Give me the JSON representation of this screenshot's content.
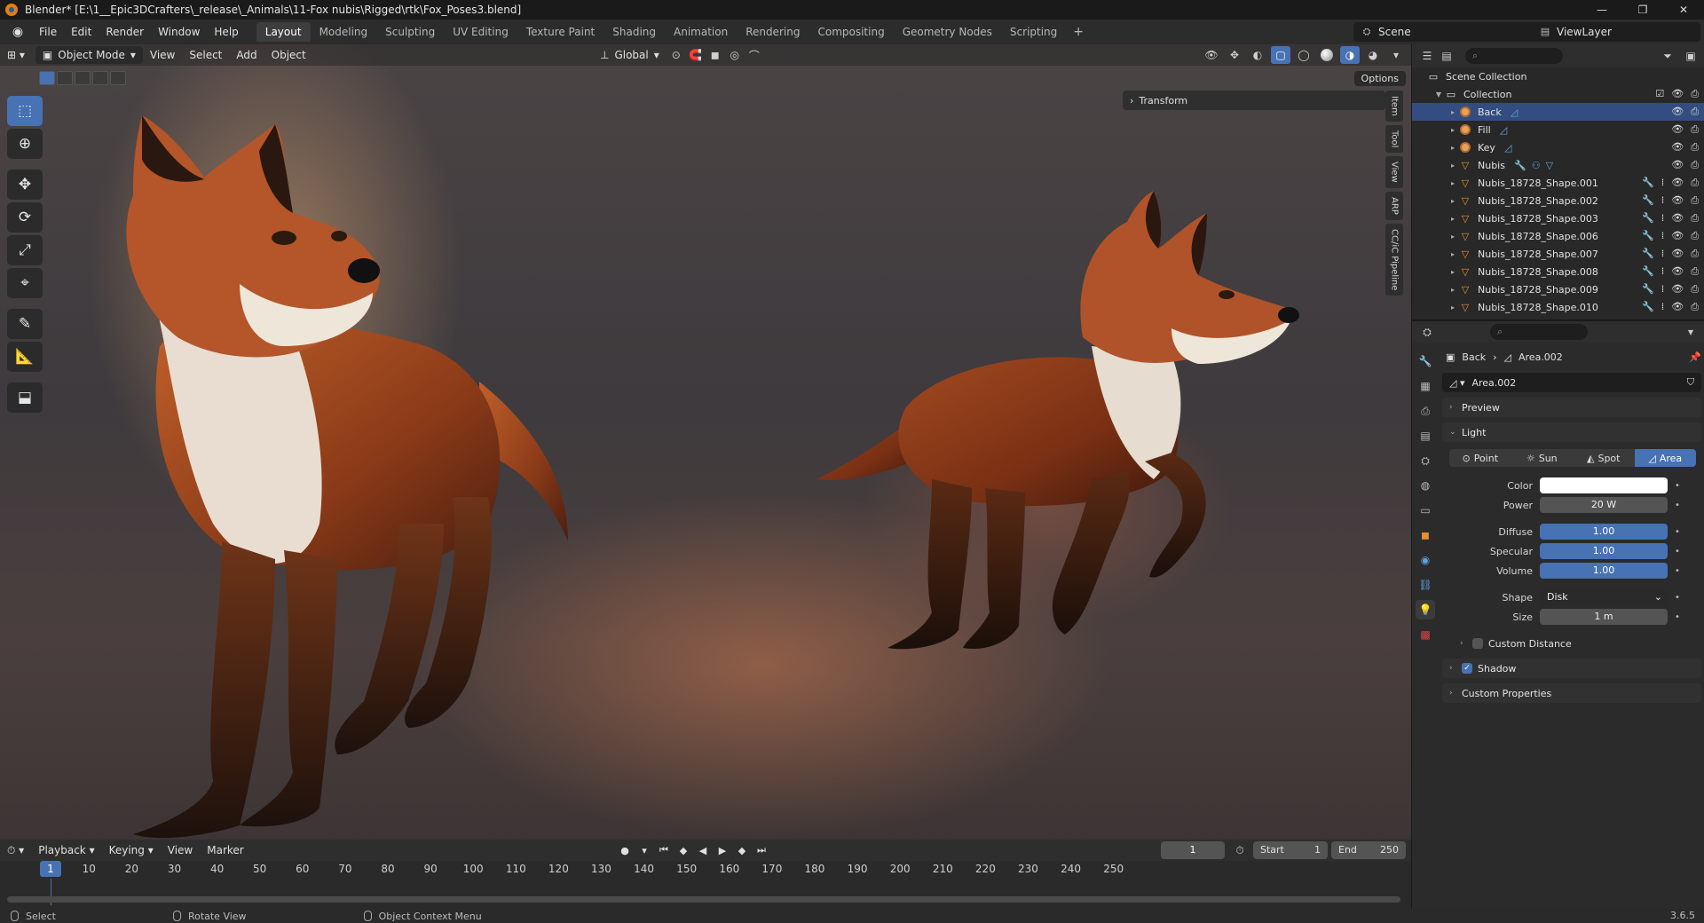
{
  "window": {
    "title": "Blender* [E:\\1__Epic3DCrafters\\_release\\_Animals\\11-Fox nubis\\Rigged\\rtk\\Fox_Poses3.blend]",
    "controls": [
      "—",
      "❐",
      "✕"
    ]
  },
  "menu": [
    "File",
    "Edit",
    "Render",
    "Window",
    "Help"
  ],
  "workspaces": [
    {
      "label": "Layout",
      "active": true
    },
    {
      "label": "Modeling"
    },
    {
      "label": "Sculpting"
    },
    {
      "label": "UV Editing"
    },
    {
      "label": "Texture Paint"
    },
    {
      "label": "Shading"
    },
    {
      "label": "Animation"
    },
    {
      "label": "Rendering"
    },
    {
      "label": "Compositing"
    },
    {
      "label": "Geometry Nodes"
    },
    {
      "label": "Scripting"
    }
  ],
  "workspace_add": "+",
  "scene": "Scene",
  "view_layer": "ViewLayer",
  "viewport": {
    "mode": "Object Mode",
    "menus": [
      "View",
      "Select",
      "Add",
      "Object"
    ],
    "orientation": "Global",
    "options": "Options",
    "transform_panel": "Transform",
    "side_tabs": [
      "Item",
      "Tool",
      "View",
      "ARP",
      "CC/iC Pipeline"
    ],
    "tools": [
      "select-box",
      "cursor",
      "move",
      "rotate",
      "scale",
      "transform",
      "annotate",
      "measure",
      "add-cube"
    ]
  },
  "timeline": {
    "menus": [
      "Playback",
      "Keying",
      "View",
      "Marker"
    ],
    "current_frame": "1",
    "start_label": "Start",
    "start": "1",
    "end_label": "End",
    "end": "250",
    "ticks": [
      "10",
      "20",
      "30",
      "40",
      "50",
      "60",
      "70",
      "80",
      "90",
      "100",
      "110",
      "120",
      "130",
      "140",
      "150",
      "160",
      "170",
      "180",
      "190",
      "200",
      "210",
      "220",
      "230",
      "240",
      "250"
    ],
    "cursor_label": "1"
  },
  "status": {
    "items": [
      "Select",
      "Rotate View",
      "Object Context Menu"
    ],
    "version": "3.6.5"
  },
  "outliner": {
    "root": "Scene Collection",
    "collection": "Collection",
    "items": [
      {
        "name": "Back",
        "kind": "light",
        "selected": true
      },
      {
        "name": "Fill",
        "kind": "light"
      },
      {
        "name": "Key",
        "kind": "light"
      },
      {
        "name": "Nubis",
        "kind": "armature"
      },
      {
        "name": "Nubis_18728_Shape.001",
        "kind": "mesh"
      },
      {
        "name": "Nubis_18728_Shape.002",
        "kind": "mesh"
      },
      {
        "name": "Nubis_18728_Shape.003",
        "kind": "mesh"
      },
      {
        "name": "Nubis_18728_Shape.006",
        "kind": "mesh"
      },
      {
        "name": "Nubis_18728_Shape.007",
        "kind": "mesh"
      },
      {
        "name": "Nubis_18728_Shape.008",
        "kind": "mesh"
      },
      {
        "name": "Nubis_18728_Shape.009",
        "kind": "mesh"
      },
      {
        "name": "Nubis_18728_Shape.010",
        "kind": "mesh"
      }
    ]
  },
  "properties": {
    "breadcrumb_object": "Back",
    "breadcrumb_data": "Area.002",
    "datablock": "Area.002",
    "panels": {
      "preview": "Preview",
      "light": "Light",
      "custom_distance": "Custom Distance",
      "shadow": "Shadow",
      "custom_properties": "Custom Properties"
    },
    "light_types": [
      {
        "label": "Point"
      },
      {
        "label": "Sun"
      },
      {
        "label": "Spot"
      },
      {
        "label": "Area",
        "active": true
      }
    ],
    "fields": {
      "color_label": "Color",
      "power_label": "Power",
      "power": "20 W",
      "diffuse_label": "Diffuse",
      "diffuse": "1.00",
      "specular_label": "Specular",
      "specular": "1.00",
      "volume_label": "Volume",
      "volume": "1.00",
      "shape_label": "Shape",
      "shape": "Disk",
      "size_label": "Size",
      "size": "1 m"
    },
    "colors": {
      "light_color": "#ffffff",
      "accent": "#4772b3"
    }
  }
}
